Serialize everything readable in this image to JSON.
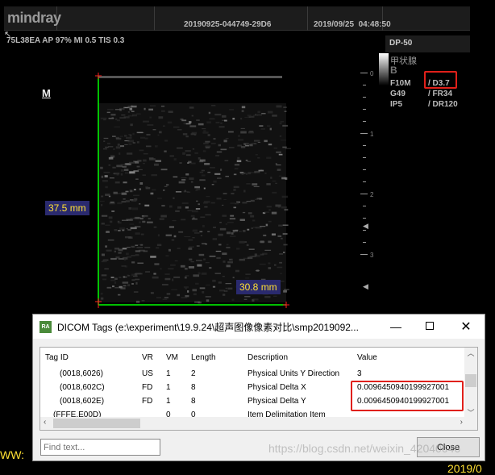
{
  "ultrasound": {
    "brand": "mindray",
    "exam_id": "20190925-044749-29D6",
    "datetime": "2019/09/25  04:48:50",
    "probe_info": "75L38EA  AP 97%  MI 0.5 TIS 0.3",
    "preset": "DP-50",
    "organ": "甲状腺",
    "mode": "B",
    "params_left": [
      "F10M",
      "G49",
      "IP5"
    ],
    "params_right": [
      "/ D3.7",
      "/ FR34",
      "/ DR120"
    ],
    "mode_marker": "M",
    "scale_labels": [
      "0",
      "1",
      "2",
      "3"
    ],
    "measure_vertical": "37.5 mm",
    "measure_horizontal": "30.8 mm",
    "bottom_left": "WW:",
    "bottom_right": "2019/0",
    "highlight_color": "#e0201a",
    "caliper_color": "#00ff00"
  },
  "dialog": {
    "icon_text": "RA",
    "title": "DICOM Tags (e:\\experiment\\19.9.24\\超声图像像素对比\\smp2019092...",
    "columns": [
      "Tag ID",
      "VR",
      "VM",
      "Length",
      "Description",
      "Value"
    ],
    "rows": [
      [
        "(0018,6026)",
        "US",
        "1",
        "2",
        "Physical Units Y Direction",
        "3"
      ],
      [
        "(0018,602C)",
        "FD",
        "1",
        "8",
        "Physical Delta X",
        "0.00964509401999270​01"
      ],
      [
        "(0018,602E)",
        "FD",
        "1",
        "8",
        "Physical Delta Y",
        "0.00964509401999270​01"
      ],
      [
        "(FFFE,E00D)",
        "",
        "0",
        "0",
        "Item Delimitation Item",
        ""
      ]
    ],
    "find_placeholder": "Find text...",
    "close_label": "Close",
    "watermark": "https://blog.csdn.net/weixin_42040046"
  }
}
